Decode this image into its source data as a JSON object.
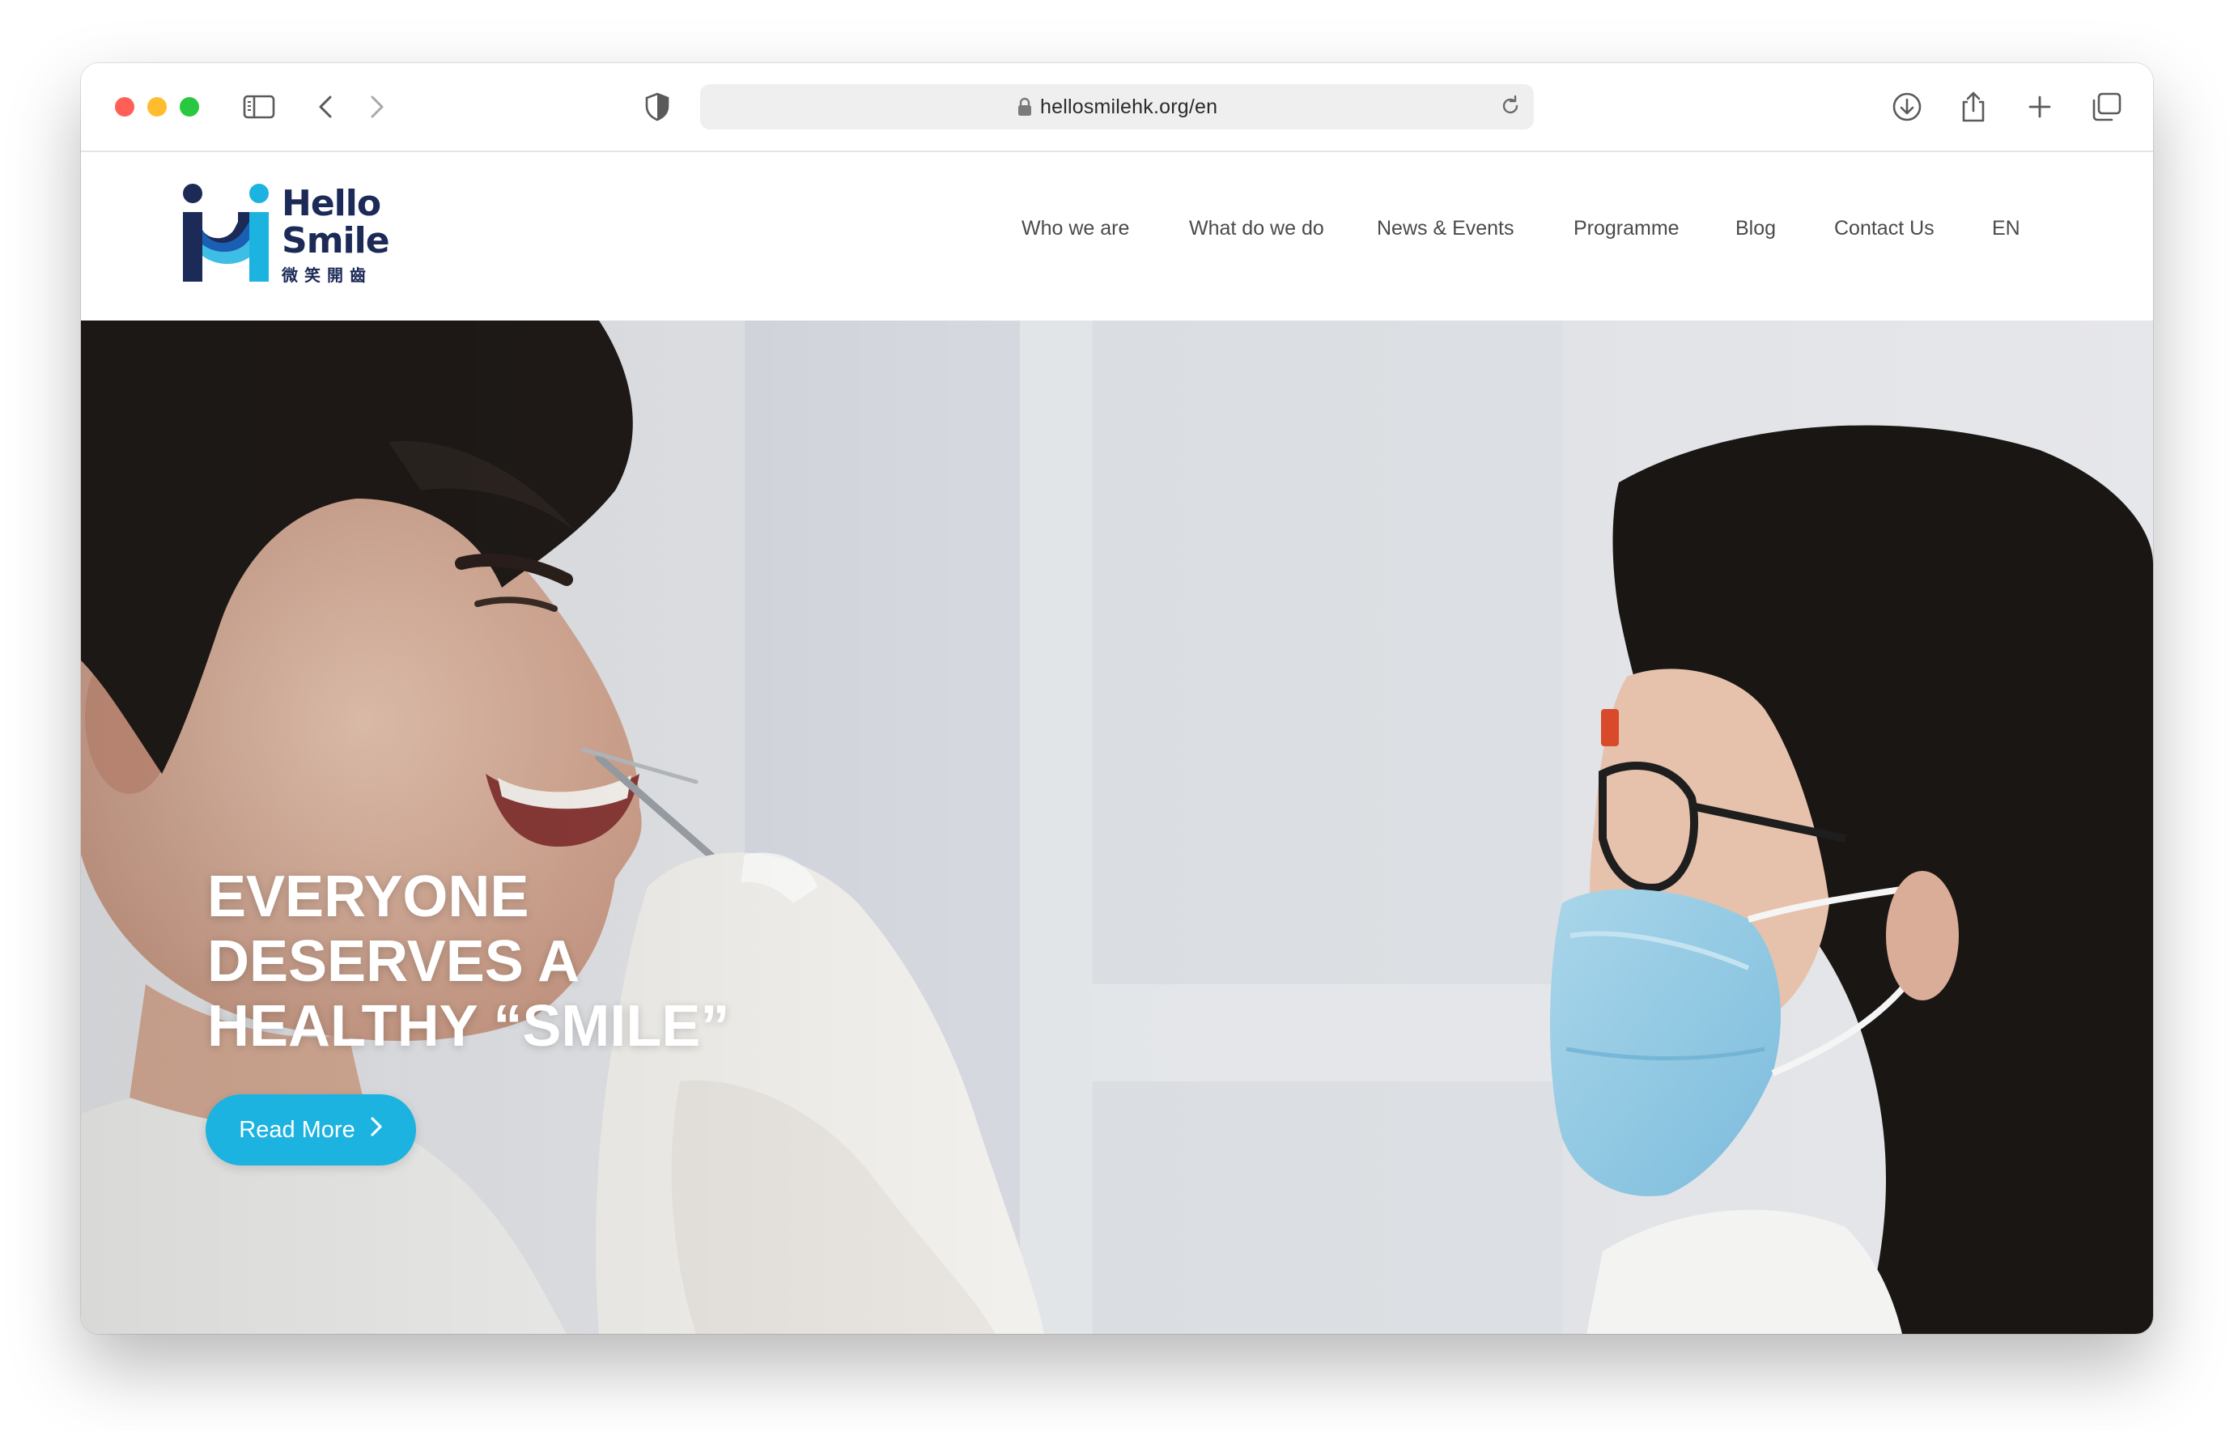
{
  "browser": {
    "url": "hellosmilehk.org/en",
    "traffic_colors": {
      "close": "#ff5f57",
      "minimize": "#febc2e",
      "zoom": "#28c840"
    },
    "icons": [
      "sidebar-icon",
      "back-chevron-icon",
      "forward-chevron-icon",
      "shield-icon",
      "lock-icon",
      "reload-icon",
      "download-icon",
      "share-icon",
      "new-tab-plus-icon",
      "tabs-overview-icon"
    ]
  },
  "site": {
    "logo": {
      "line1": "Hello",
      "line2": "Smile",
      "line3": "微笑開齒",
      "colors": {
        "navy": "#1b2a57",
        "cyan": "#1db3e0",
        "blue": "#1a5fb4"
      }
    },
    "nav": [
      {
        "label": "Who we are"
      },
      {
        "label": "What do we do"
      },
      {
        "label": "News & Events"
      },
      {
        "label": "Programme"
      },
      {
        "label": "Blog"
      },
      {
        "label": "Contact Us"
      },
      {
        "label": "EN"
      }
    ]
  },
  "hero": {
    "title_lines": [
      "EVERYONE",
      "DESERVES A",
      "HEALTHY “SMILE”"
    ],
    "cta_label": "Read More",
    "accent": "#1db3e0"
  }
}
